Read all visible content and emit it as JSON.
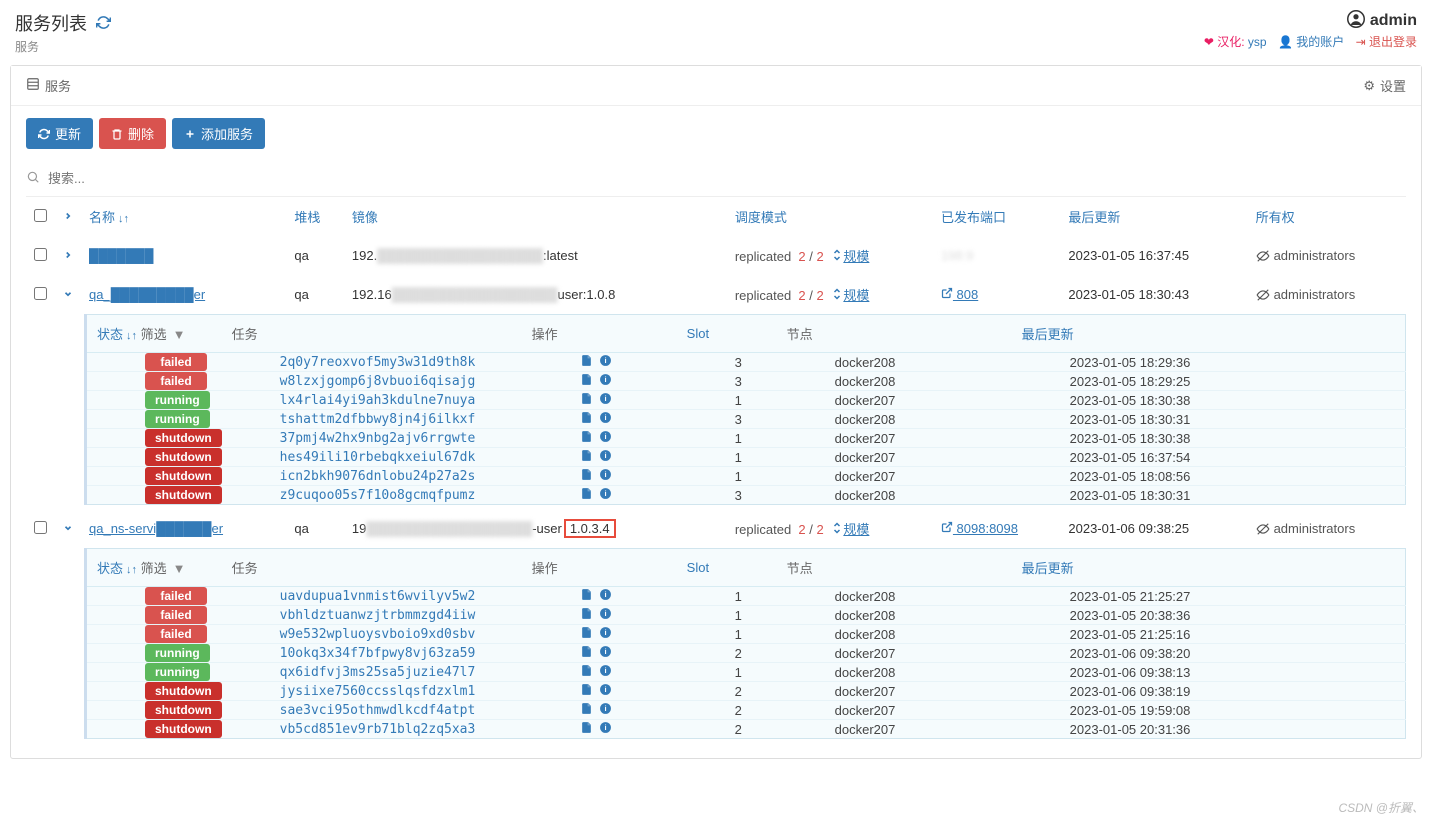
{
  "header": {
    "title": "服务列表",
    "breadcrumb": "服务",
    "username": "admin",
    "hanhua_label": "汉化:",
    "hanhua_value": "ysp",
    "my_account": "我的账户",
    "logout": "退出登录"
  },
  "panel": {
    "title": "服务",
    "settings": "设置"
  },
  "toolbar": {
    "update": "更新",
    "delete": "删除",
    "add": "添加服务"
  },
  "search": {
    "placeholder": "搜索..."
  },
  "columns": {
    "name": "名称",
    "stack": "堆栈",
    "image": "镜像",
    "sched": "调度模式",
    "ports": "已发布端口",
    "updated": "最后更新",
    "owner": "所有权"
  },
  "subcolumns": {
    "status": "状态",
    "filter": "筛选",
    "task": "任务",
    "action": "操作",
    "slot": "Slot",
    "node": "节点",
    "updated": "最后更新"
  },
  "sched_label": "replicated",
  "scale_label": "规模",
  "owner_label": "administrators",
  "services": [
    {
      "expanded": false,
      "name": "███████",
      "stack": "qa",
      "image_pre": "192.",
      "image_suf": ":latest",
      "rep_a": "2",
      "rep_b": "2",
      "port_pre": "",
      "port_mid": "198:9",
      "port_suf": "",
      "port_blur": true,
      "updated": "2023-01-05 16:37:45",
      "tasks": []
    },
    {
      "expanded": true,
      "name": "qa_█████████er",
      "stack": "qa",
      "image_pre": "192.16",
      "image_suf": "user:1.0.8",
      "rep_a": "2",
      "rep_b": "2",
      "port_pre": "808",
      "port_suf": "",
      "updated": "2023-01-05 18:30:43",
      "tasks": [
        {
          "status": "failed",
          "task": "2q0y7reoxvof5my3w31d9th8k",
          "slot": "3",
          "node": "docker208",
          "updated": "2023-01-05 18:29:36"
        },
        {
          "status": "failed",
          "task": "w8lzxjgomp6j8vbuoi6qisajg",
          "slot": "3",
          "node": "docker208",
          "updated": "2023-01-05 18:29:25"
        },
        {
          "status": "running",
          "task": "lx4rlai4yi9ah3kdulne7nuya",
          "slot": "1",
          "node": "docker207",
          "updated": "2023-01-05 18:30:38"
        },
        {
          "status": "running",
          "task": "tshattm2dfbbwy8jn4j6ilkxf",
          "slot": "3",
          "node": "docker208",
          "updated": "2023-01-05 18:30:31"
        },
        {
          "status": "shutdown",
          "task": "37pmj4w2hx9nbg2ajv6rrgwte",
          "slot": "1",
          "node": "docker207",
          "updated": "2023-01-05 18:30:38"
        },
        {
          "status": "shutdown",
          "task": "hes49ili10rbebqkxeiul67dk",
          "slot": "1",
          "node": "docker207",
          "updated": "2023-01-05 16:37:54"
        },
        {
          "status": "shutdown",
          "task": "icn2bkh9076dnlobu24p27a2s",
          "slot": "1",
          "node": "docker207",
          "updated": "2023-01-05 18:08:56"
        },
        {
          "status": "shutdown",
          "task": "z9cuqoo05s7f10o8gcmqfpumz",
          "slot": "3",
          "node": "docker208",
          "updated": "2023-01-05 18:30:31"
        }
      ]
    },
    {
      "expanded": true,
      "name": "qa_ns-servi██████er",
      "stack": "qa",
      "image_pre": "19",
      "image_suf": "-user",
      "image_marked": "1.0.3.4",
      "rep_a": "2",
      "rep_b": "2",
      "port_pre": "8098:8098",
      "port_suf": "",
      "updated": "2023-01-06 09:38:25",
      "tasks": [
        {
          "status": "failed",
          "task": "uavdupua1vnmist6wvilyv5w2",
          "slot": "1",
          "node": "docker208",
          "updated": "2023-01-05 21:25:27"
        },
        {
          "status": "failed",
          "task": "vbhldztuanwzjtrbmmzgd4iiw",
          "slot": "1",
          "node": "docker208",
          "updated": "2023-01-05 20:38:36"
        },
        {
          "status": "failed",
          "task": "w9e532wpluoysvboio9xd0sbv",
          "slot": "1",
          "node": "docker208",
          "updated": "2023-01-05 21:25:16"
        },
        {
          "status": "running",
          "task": "10okq3x34f7bfpwy8vj63za59",
          "slot": "2",
          "node": "docker207",
          "updated": "2023-01-06 09:38:20"
        },
        {
          "status": "running",
          "task": "qx6idfvj3ms25sa5juzie47l7",
          "slot": "1",
          "node": "docker208",
          "updated": "2023-01-06 09:38:13"
        },
        {
          "status": "shutdown",
          "task": "jysiixe7560ccsslqsfdzxlm1",
          "slot": "2",
          "node": "docker207",
          "updated": "2023-01-06 09:38:19"
        },
        {
          "status": "shutdown",
          "task": "sae3vci95othmwdlkcdf4atpt",
          "slot": "2",
          "node": "docker207",
          "updated": "2023-01-05 19:59:08"
        },
        {
          "status": "shutdown",
          "task": "vb5cd851ev9rb71blq2zq5xa3",
          "slot": "2",
          "node": "docker207",
          "updated": "2023-01-05 20:31:36"
        }
      ]
    }
  ],
  "watermark": "CSDN @折翼、"
}
